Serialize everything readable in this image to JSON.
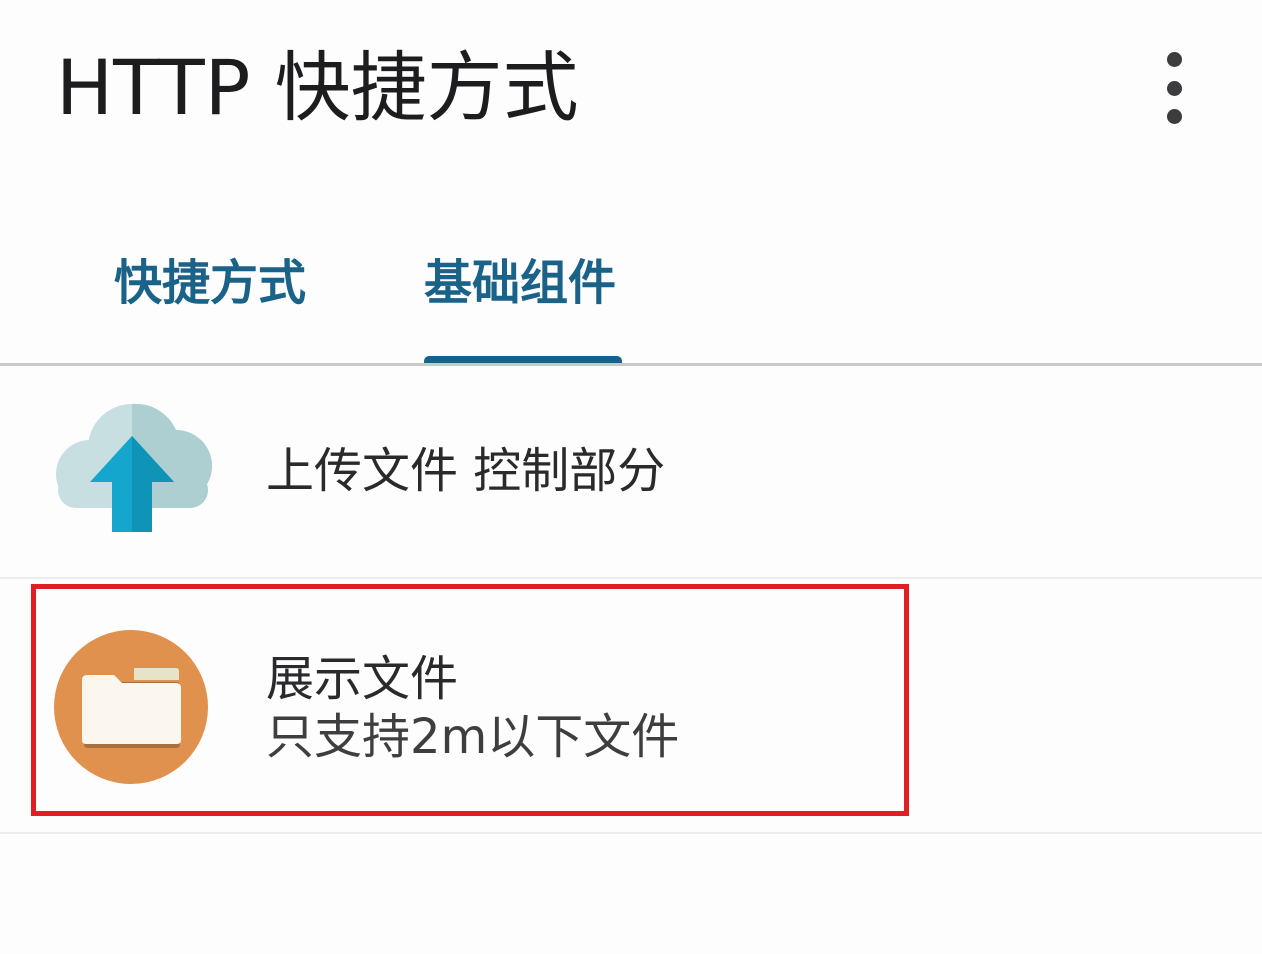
{
  "appbar": {
    "title": "HTTP 快捷方式",
    "menu_icon": "more-vert-icon"
  },
  "tabs": [
    {
      "label": "快捷方式",
      "selected": false
    },
    {
      "label": "基础组件",
      "selected": true
    }
  ],
  "list": [
    {
      "title": "上传文件 控制部分",
      "icon": "cloud-upload-icon"
    },
    {
      "title": "展示文件",
      "subtitle": "只支持2m以下文件",
      "icon": "folder-icon"
    }
  ],
  "colors": {
    "tab_text": "#1b6289",
    "tab_indicator": "#16628c",
    "highlight": "#e01f22",
    "folder_circle": "#e0914e",
    "cloud": "#b9d6d8",
    "arrow": "#12a3c9"
  }
}
